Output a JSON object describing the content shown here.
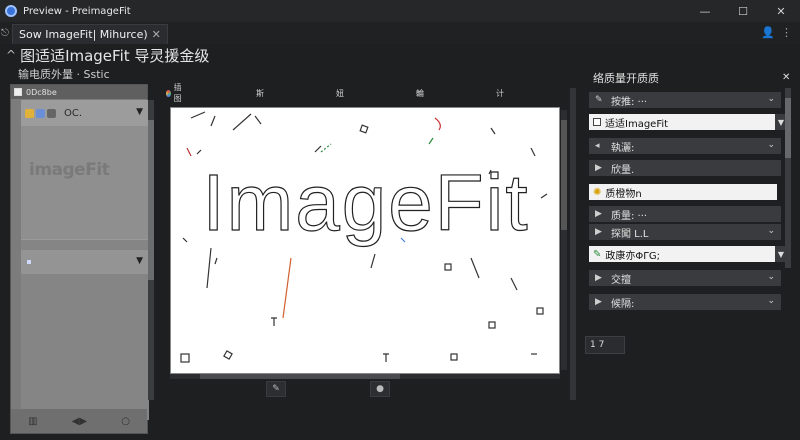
{
  "window": {
    "title": "Preview - PreimageFit",
    "minimize": "—",
    "maximize": "☐",
    "close": "✕"
  },
  "tabs": [
    {
      "label": "Sow ImageFit",
      "extra": "| Mihurce)",
      "close": "✕"
    }
  ],
  "header": {
    "title": "图适适ImageFit 导灵援金级"
  },
  "subheader": "输电质外量 · Sstic",
  "left_panel": {
    "head_label": "0Dc8be",
    "card_label": "OC.",
    "thumb_text": "imageFit"
  },
  "canvas": {
    "toolbar": [
      "插图",
      "斯",
      "妞",
      "輪",
      "计"
    ],
    "word": "ImageFit"
  },
  "right_panel": {
    "title": "络质量开质质",
    "rows": [
      {
        "label": "按推: ···",
        "icon": "▸"
      },
      {
        "label": "适适ImageFit",
        "field": true,
        "checkbox": true
      },
      {
        "label": "執灑:",
        "icon": "◂"
      },
      {
        "label": "欣量.",
        "icon": "▶"
      },
      {
        "label": "质橙物n",
        "field": true
      },
      {
        "label": "质量: ···",
        "icon": "▶"
      },
      {
        "label": "探闖 L.L",
        "icon": "▶"
      },
      {
        "label": "政康亦ΦΓG;",
        "field": true
      },
      {
        "label": "交擅",
        "icon": "▶"
      },
      {
        "label": "候隔:",
        "icon": "▶"
      }
    ],
    "number_field": "1    7"
  }
}
